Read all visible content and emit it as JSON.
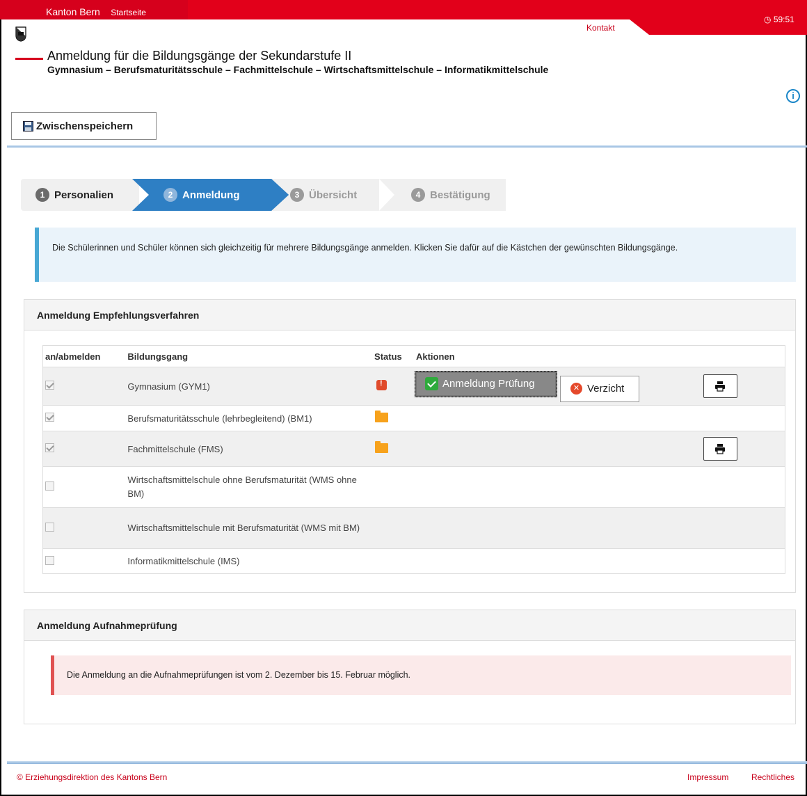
{
  "topbar": {
    "kanton": "Kanton Bern",
    "startseite": "Startseite",
    "kontakt": "Kontakt",
    "timer": "59:51"
  },
  "header": {
    "title": "Anmeldung für die Bildungsgänge der Sekundarstufe II",
    "subtitle": "Gymnasium – Berufsmaturitätsschule – Fachmittelschule – Wirtschaftsmittelschule – Informatikmittelschule"
  },
  "toolbar": {
    "save_label": "Zwischenspeichern"
  },
  "wizard": {
    "steps": [
      {
        "num": "1",
        "label": "Personalien"
      },
      {
        "num": "2",
        "label": "Anmeldung"
      },
      {
        "num": "3",
        "label": "Übersicht"
      },
      {
        "num": "4",
        "label": "Bestätigung"
      }
    ]
  },
  "info": {
    "text": "Die Schülerinnen und Schüler können sich gleichzeitig für mehrere Bildungsgänge anmelden. Klicken Sie dafür auf die Kästchen der gewünschten Bildungsgänge."
  },
  "empfehlung": {
    "title": "Anmeldung Empfehlungsverfahren",
    "columns": {
      "select": "an/abmelden",
      "bildungsgang": "Bildungsgang",
      "status": "Status",
      "aktionen": "Aktionen"
    },
    "rows": [
      {
        "label": "Gymnasium (GYM1)"
      },
      {
        "label": "Berufsmaturitätsschule (lehrbegleitend) (BM1)"
      },
      {
        "label": "Fachmittelschule (FMS)"
      },
      {
        "label": "Wirtschaftsmittelschule ohne Berufsmaturität (WMS ohne BM)"
      },
      {
        "label": "Wirtschaftsmittelschule mit Berufsmaturität (WMS mit BM)"
      },
      {
        "label": "Informatikmittelschule (IMS)"
      }
    ],
    "actions": {
      "anmeldung": "Anmeldung Prüfung",
      "verzicht": "Verzicht"
    }
  },
  "aufnahme": {
    "title": "Anmeldung Aufnahmeprüfung",
    "alert": "Die Anmeldung an die Aufnahmeprüfungen ist vom 2. Dezember bis 15. Februar möglich."
  },
  "footer": {
    "copyright": "© Erziehungsdirektion des Kantons Bern",
    "impressum": "Impressum",
    "rechtliches": "Rechtliches"
  },
  "colors": {
    "brand_red": "#e2001a",
    "wizard_active": "#2e7fc4"
  }
}
